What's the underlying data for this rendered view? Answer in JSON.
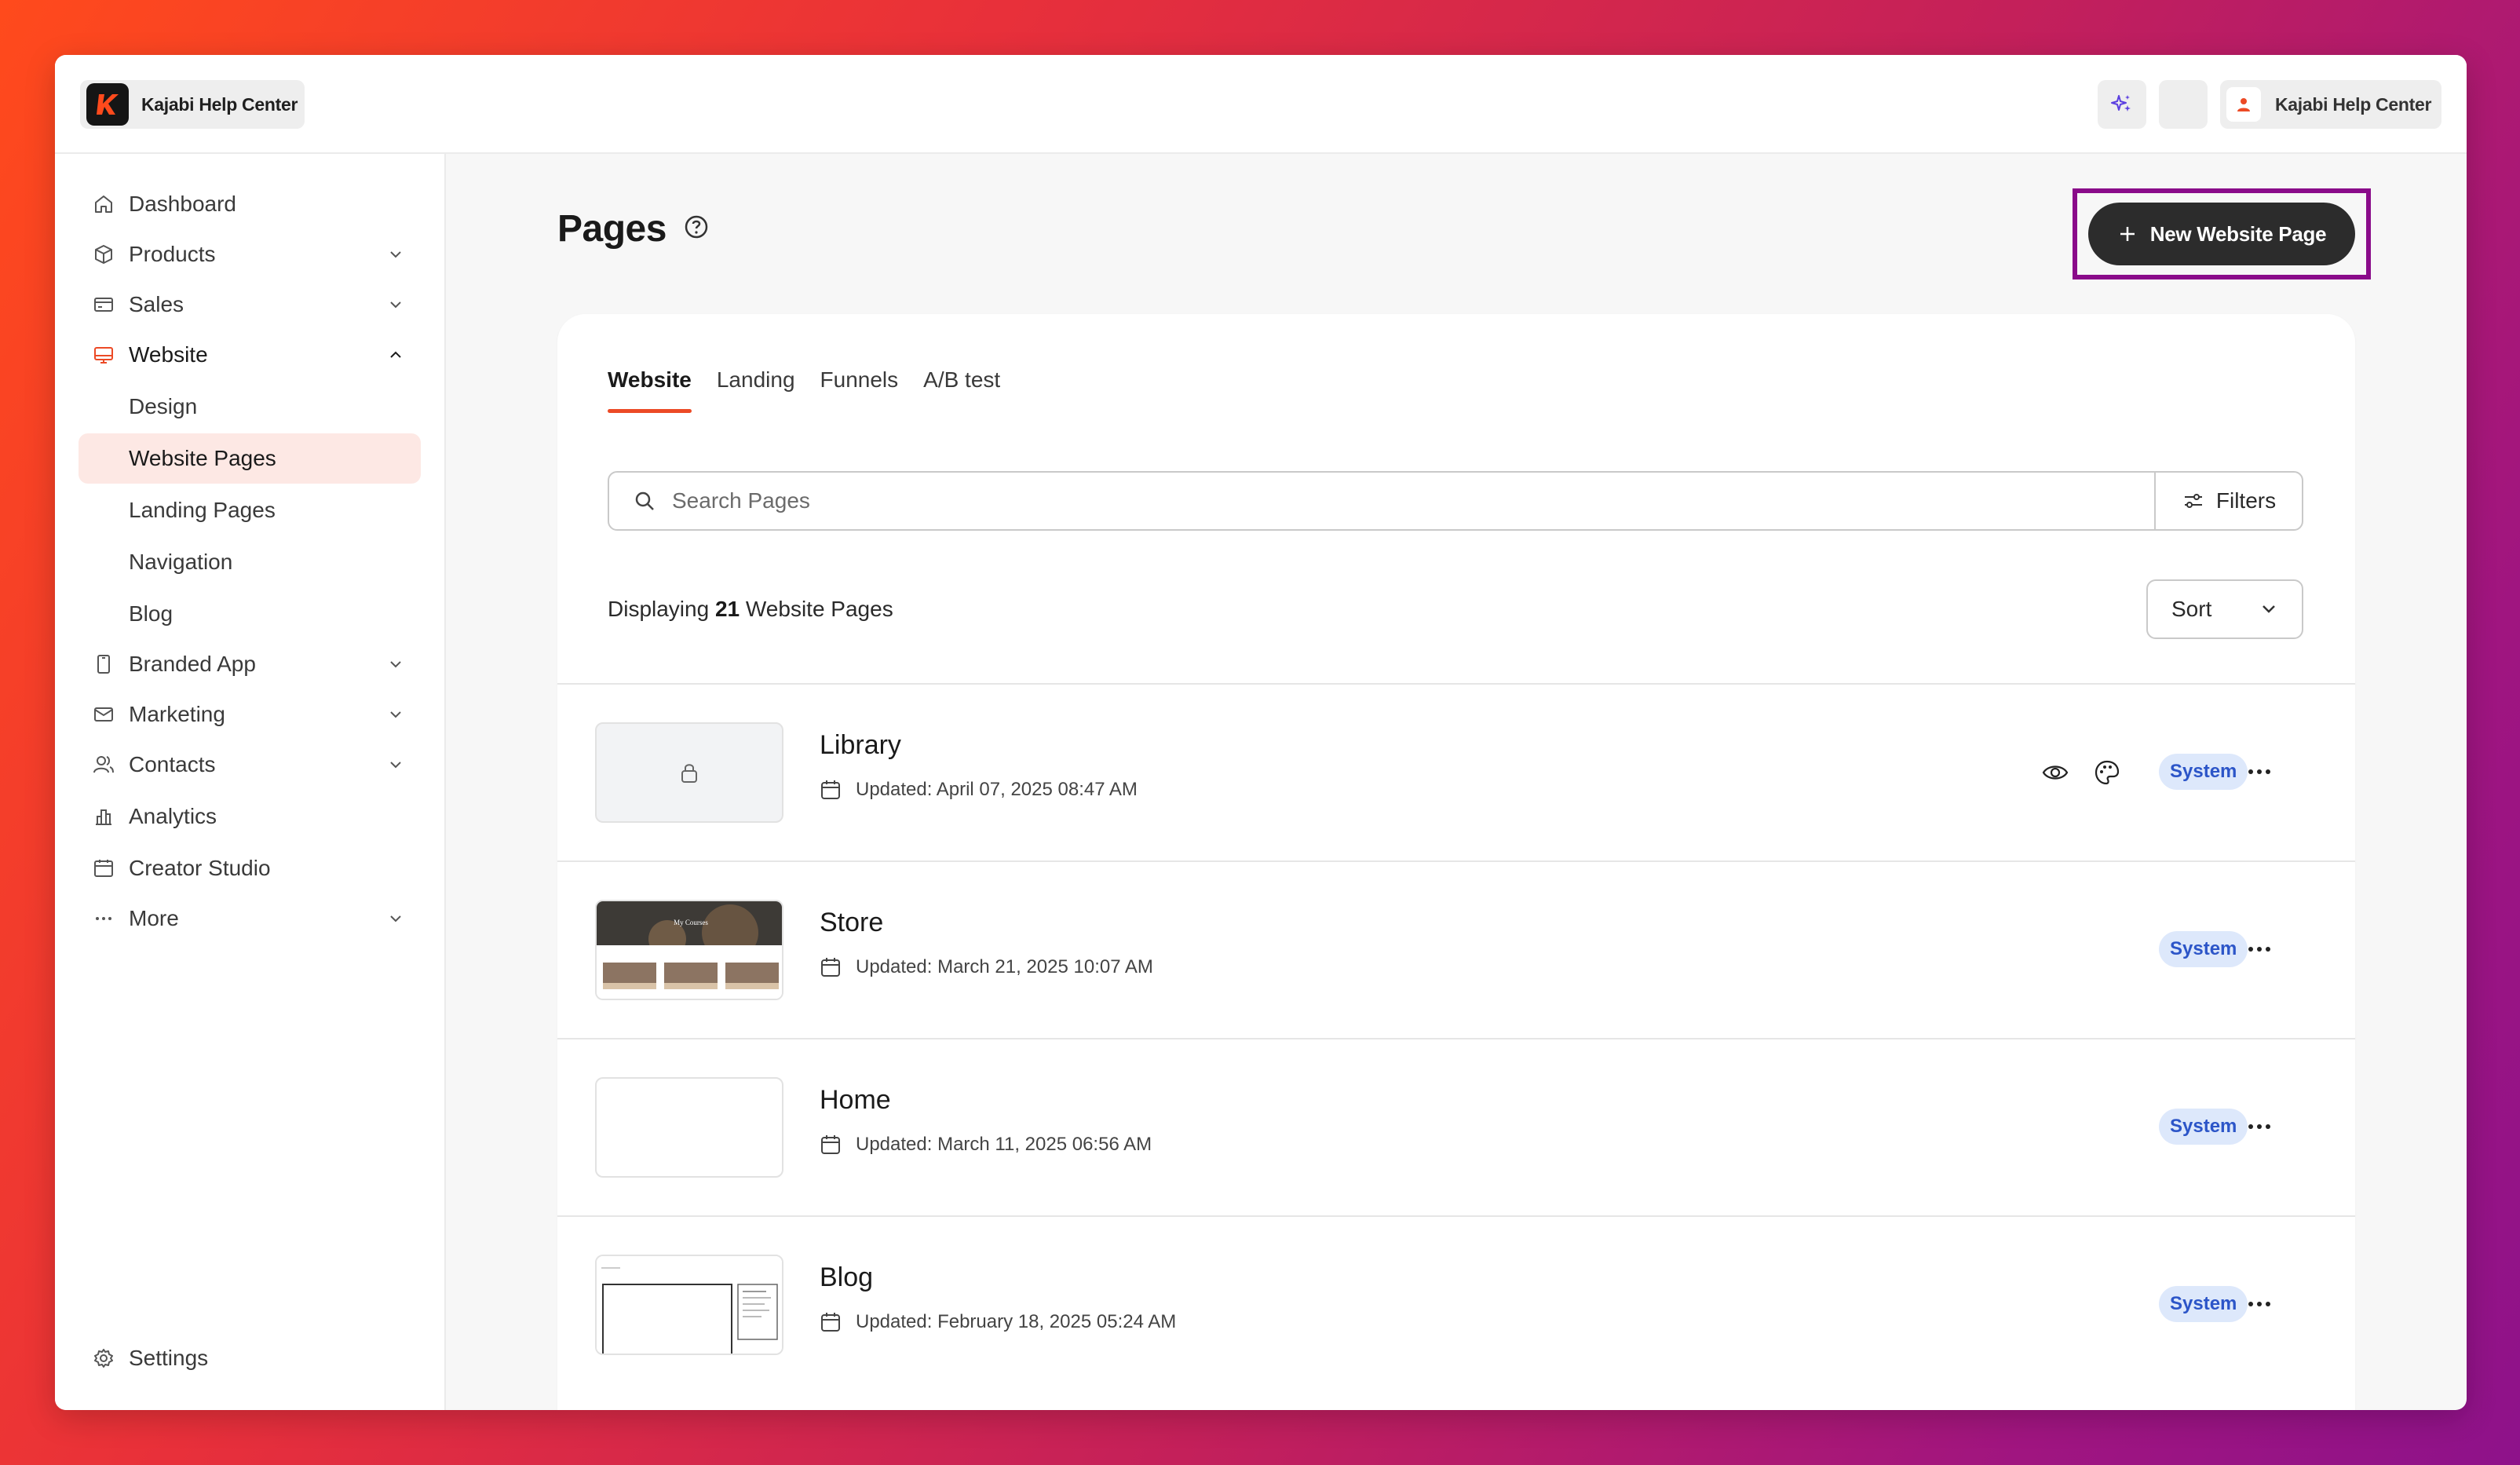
{
  "colors": {
    "accent": "#ec4a26",
    "selected_bg": "#fde8e4",
    "badge_bg": "#dde8fb",
    "badge_text": "#2c55c8",
    "highlight_frame": "#8a0b8a",
    "primary_button": "#2c2c2c"
  },
  "topbar": {
    "site_name": "Kajabi Help Center",
    "user_name": "Kajabi Help Center",
    "icons": [
      "kajabi-logo-icon",
      "sparkle-icon",
      "user-icon"
    ]
  },
  "sidebar": {
    "items": [
      {
        "label": "Dashboard",
        "icon": "home-icon"
      },
      {
        "label": "Products",
        "icon": "box-icon"
      },
      {
        "label": "Sales",
        "icon": "credit-card-icon"
      },
      {
        "label": "Website",
        "icon": "monitor-icon"
      },
      {
        "label": "Branded App",
        "icon": "phone-icon"
      },
      {
        "label": "Marketing",
        "icon": "mail-icon"
      },
      {
        "label": "Contacts",
        "icon": "users-icon"
      },
      {
        "label": "Analytics",
        "icon": "bar-chart-icon"
      },
      {
        "label": "Creator Studio",
        "icon": "calendar-icon"
      },
      {
        "label": "More",
        "icon": "dots-icon"
      }
    ],
    "website_subitems": [
      "Design",
      "Website Pages",
      "Landing Pages",
      "Navigation",
      "Blog"
    ],
    "settings_label": "Settings"
  },
  "main": {
    "title": "Pages",
    "new_button_label": "New Website Page",
    "tabs": [
      "Website",
      "Landing",
      "Funnels",
      "A/B test"
    ],
    "search_placeholder": "Search Pages",
    "filters_label": "Filters",
    "displaying_prefix": "Displaying ",
    "displaying_count": "21",
    "displaying_suffix": " Website Pages",
    "sort_label": "Sort",
    "pages": [
      {
        "title": "Library",
        "updated": "Updated: April 07, 2025 08:47 AM",
        "badge": "System"
      },
      {
        "title": "Store",
        "updated": "Updated: March 21, 2025 10:07 AM",
        "badge": "System"
      },
      {
        "title": "Home",
        "updated": "Updated: March 11, 2025 06:56 AM",
        "badge": "System"
      },
      {
        "title": "Blog",
        "updated": "Updated: February 18, 2025 05:24 AM",
        "badge": "System"
      }
    ],
    "store_thumb_text": "My Courses"
  }
}
